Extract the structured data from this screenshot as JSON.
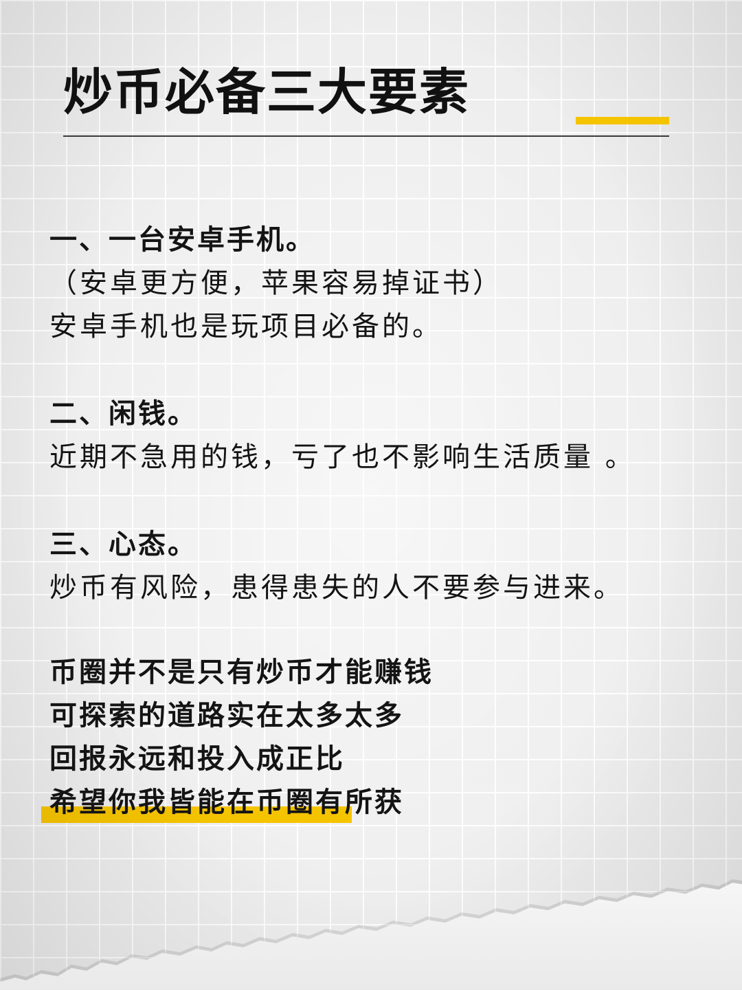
{
  "title": "炒币必备三大要素",
  "sections": [
    {
      "heading": "一、一台安卓手机。",
      "lines": [
        "（安卓更方便，苹果容易掉证书）",
        "安卓手机也是玩项目必备的。"
      ]
    },
    {
      "heading": "二、闲钱。",
      "lines": [
        "近期不急用的钱，亏了也不影响生活质量 。"
      ]
    },
    {
      "heading": "三、心态。",
      "lines": [
        "炒币有风险，患得患失的人不要参与进来。"
      ]
    }
  ],
  "closing": [
    "币圈并不是只有炒币才能赚钱",
    "可探索的道路实在太多太多",
    "回报永远和投入成正比",
    "希望你我皆能在币圈有所获"
  ],
  "colors": {
    "accent": "#f5c400",
    "text": "#141414",
    "background": "#ededed"
  }
}
